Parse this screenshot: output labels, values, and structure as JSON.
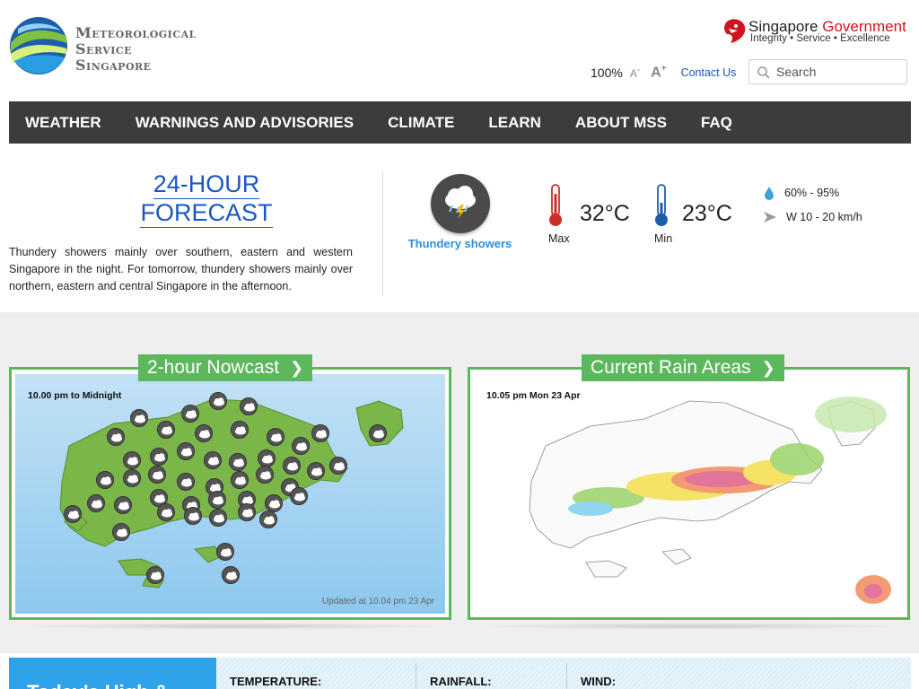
{
  "header": {
    "logo": [
      "Meteorological",
      "Service",
      "Singapore"
    ],
    "gov_name_a": "Singapore",
    "gov_name_b": "Government",
    "gov_tagline": "Integrity • Service • Excellence",
    "zoom": "100%",
    "font_small": "A",
    "font_small_sup": "-",
    "font_big": "A",
    "font_big_sup": "+",
    "contact": "Contact Us",
    "search_placeholder": "Search"
  },
  "nav": [
    "WEATHER",
    "WARNINGS AND ADVISORIES",
    "CLIMATE",
    "LEARN",
    "ABOUT MSS",
    "FAQ"
  ],
  "forecast": {
    "title_line1": "24-HOUR",
    "title_line2": "FORECAST",
    "text": "Thundery showers mainly over southern, eastern and western Singapore in the night. For tomorrow, thundery showers mainly over northern, eastern and central Singapore in the afternoon.",
    "condition": "Thundery showers",
    "max_temp": "32°C",
    "max_label": "Max",
    "min_temp": "23°C",
    "min_label": "Min",
    "humidity": "60% - 95%",
    "wind": "W 10 - 20 km/h"
  },
  "nowcast": {
    "title": "2-hour Nowcast",
    "period": "10.00 pm to Midnight",
    "updated": "Updated at 10.04 pm 23 Apr"
  },
  "rain": {
    "title": "Current Rain Areas",
    "time": "10.05 pm Mon 23 Apr"
  },
  "bottom": {
    "hilo": "Today's High &",
    "temperature": "TEMPERATURE:",
    "rainfall": "RAINFALL:",
    "wind": "WIND:"
  },
  "colors": {
    "nav_bg": "#3c3c3c",
    "link_blue": "#1957c2",
    "card_green": "#5cb85c",
    "condition_blue": "#2c8fdb",
    "gov_red": "#d0141d",
    "hilo_blue": "#2ea3e9"
  }
}
